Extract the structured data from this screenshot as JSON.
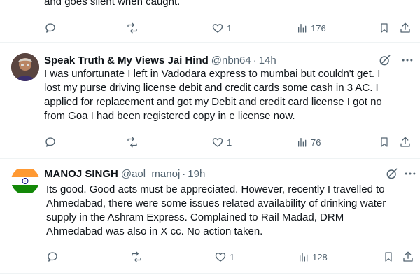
{
  "fragment": {
    "text": "and goes silent when caught.",
    "actions": {
      "replies": "",
      "reposts": "",
      "likes": "1",
      "views": "176"
    }
  },
  "tweets": [
    {
      "name": "Speak Truth & My Views Jai Hind",
      "handle": "@nbn64",
      "time": "14h",
      "lines": [
        "I was unfortunate I left in Vadodara express to mumbai but couldn't get. I",
        "lost my purse driving license debit and credit cards some cash in 3 AC. I",
        "applied for replacement and got my Debit and credit card license I got no",
        "from Goa I had been registered copy in e license now."
      ],
      "actions": {
        "replies": "",
        "reposts": "",
        "likes": "1",
        "views": "76"
      }
    },
    {
      "name": "MANOJ SINGH",
      "handle": "@aol_manoj",
      "time": "19h",
      "lines": [
        "Its good. Good acts must be appreciated. However, recently I travelled to",
        "Ahmedabad, there were some issues related availability of drinking water",
        "supply in the Ashram Express. Complained to Rail Madad, DRM",
        "Ahmedabad was also in X cc. No action taken."
      ],
      "actions": {
        "replies": "",
        "reposts": "",
        "likes": "1",
        "views": "128"
      }
    }
  ],
  "icons": {
    "reply": "reply-icon",
    "repost": "repost-icon",
    "like": "heart-icon",
    "views": "views-icon",
    "bookmark": "bookmark-icon",
    "share": "share-icon",
    "grok": "grok-icon",
    "more": "more-icon"
  },
  "colors": {
    "text": "#0f1419",
    "secondary": "#536471",
    "divider": "#eff3f4"
  }
}
